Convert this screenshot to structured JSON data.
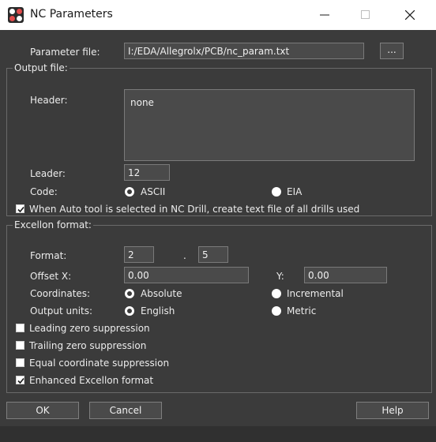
{
  "window": {
    "title": "NC Parameters"
  },
  "parameter_file": {
    "label": "Parameter file:",
    "value": "I:/EDA/Allegrolx/PCB/nc_param.txt",
    "browse_label": "..."
  },
  "output_group": {
    "title": "Output file:",
    "header_label": "Header:",
    "header_value": "none",
    "leader_label": "Leader:",
    "leader_value": "12",
    "code_label": "Code:",
    "code_options": [
      "ASCII",
      "EIA"
    ],
    "code_selected": "ASCII",
    "auto_tool_label": "When Auto tool is selected in NC Drill, create text file of all drills used",
    "auto_tool_checked": true
  },
  "excellon_group": {
    "title": "Excellon format:",
    "format_label": "Format:",
    "format_int": "2",
    "format_sep": ".",
    "format_dec": "5",
    "offset_x_label": "Offset X:",
    "offset_x_value": "0.00",
    "offset_y_label": "Y:",
    "offset_y_value": "0.00",
    "coordinates_label": "Coordinates:",
    "coordinates_options": [
      "Absolute",
      "Incremental"
    ],
    "coordinates_selected": "Absolute",
    "units_label": "Output units:",
    "units_options": [
      "English",
      "Metric"
    ],
    "units_selected": "English",
    "checkboxes": [
      {
        "label": "Leading zero suppression",
        "checked": false
      },
      {
        "label": "Trailing zero suppression",
        "checked": false
      },
      {
        "label": "Equal coordinate suppression",
        "checked": false
      },
      {
        "label": "Enhanced Excellon format",
        "checked": true
      }
    ]
  },
  "buttons": {
    "ok": "OK",
    "cancel": "Cancel",
    "help": "Help"
  },
  "colors": {
    "background": "#3b3b3b",
    "field": "#4a4a4a",
    "border": "#7a7a7a",
    "titlebar": "#ffffff"
  }
}
